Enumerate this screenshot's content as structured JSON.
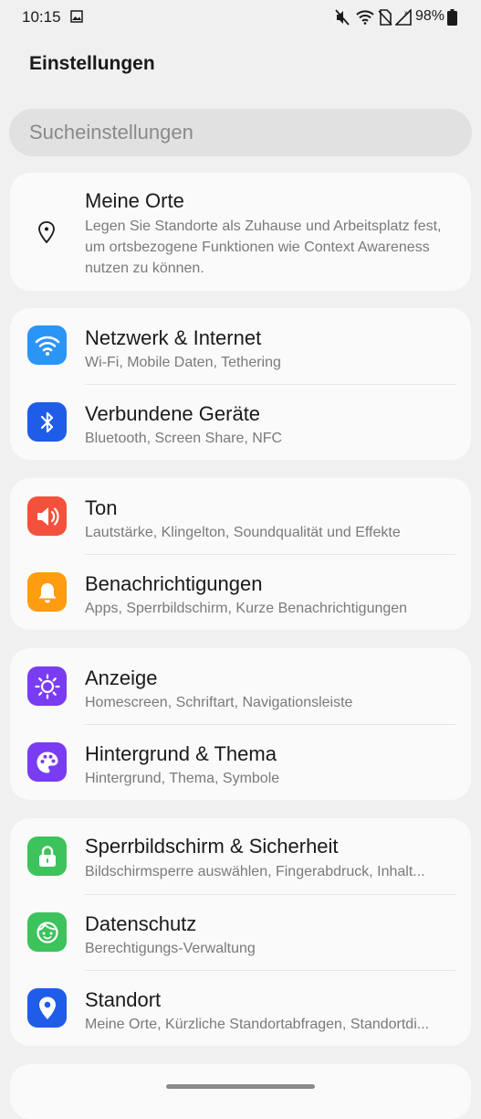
{
  "status_bar": {
    "time": "10:15",
    "battery_percent": "98%",
    "icons": [
      "image-icon",
      "mute-icon",
      "wifi-icon",
      "no-sim-icon",
      "signal-icon",
      "battery-icon"
    ]
  },
  "header": {
    "title": "Einstellungen"
  },
  "search": {
    "placeholder": "Sucheinstellungen"
  },
  "colors": {
    "network": "#2b95f6",
    "devices": "#1f5de8",
    "sound": "#f3513c",
    "notifications": "#ff9c0f",
    "display": "#7a3cf0",
    "theme": "#7a3cf0",
    "security": "#3cc35c",
    "privacy": "#3cc35c",
    "location": "#1f5de8"
  },
  "cards": [
    {
      "items": [
        {
          "icon": "location-pin-icon",
          "title": "Meine Orte",
          "subtitle": "Legen Sie Standorte als Zuhause und Arbeitsplatz fest, um ortsbezogene Funktionen wie Context Awareness nutzen zu können."
        }
      ]
    },
    {
      "items": [
        {
          "icon": "wifi-icon",
          "title": "Netzwerk & Internet",
          "subtitle": "Wi-Fi, Mobile Daten, Tethering"
        },
        {
          "icon": "bluetooth-icon",
          "title": "Verbundene Geräte",
          "subtitle": "Bluetooth, Screen Share, NFC"
        }
      ]
    },
    {
      "items": [
        {
          "icon": "speaker-icon",
          "title": "Ton",
          "subtitle": "Lautstärke, Klingelton, Soundqualität und Effekte"
        },
        {
          "icon": "bell-icon",
          "title": "Benachrichtigungen",
          "subtitle": "Apps, Sperrbildschirm, Kurze Benachrichtigungen"
        }
      ]
    },
    {
      "items": [
        {
          "icon": "sun-icon",
          "title": "Anzeige",
          "subtitle": "Homescreen, Schriftart, Navigationsleiste"
        },
        {
          "icon": "palette-icon",
          "title": "Hintergrund & Thema",
          "subtitle": "Hintergrund, Thema, Symbole"
        }
      ]
    },
    {
      "items": [
        {
          "icon": "lock-icon",
          "title": "Sperrbildschirm & Sicherheit",
          "subtitle": "Bildschirmsperre auswählen, Fingerabdruck, Inhalt..."
        },
        {
          "icon": "privacy-face-icon",
          "title": "Datenschutz",
          "subtitle": "Berechtigungs-Verwaltung"
        },
        {
          "icon": "location-pin-icon",
          "title": "Standort",
          "subtitle": "Meine Orte, Kürzliche Standortabfragen, Standortdi..."
        }
      ]
    }
  ]
}
